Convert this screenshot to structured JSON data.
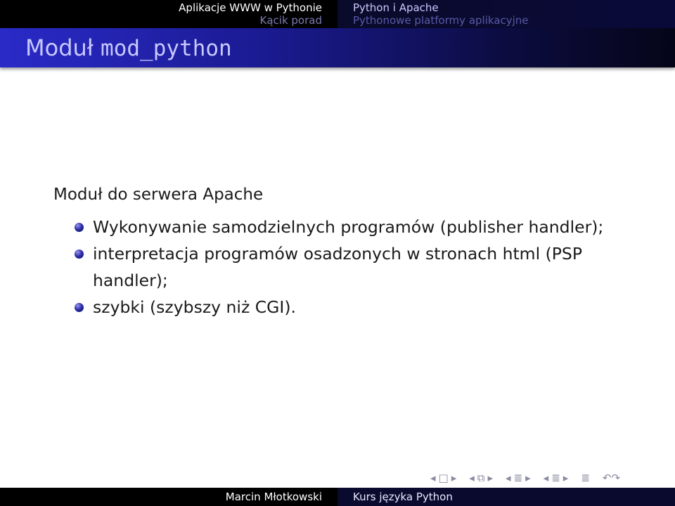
{
  "headline": {
    "left": {
      "section_current": "Aplikacje WWW w Pythonie",
      "section_other": "Kącik porad"
    },
    "right": {
      "subsection_current": "Python i Apache",
      "subsection_other": "Pythonowe platformy aplikacyjne"
    }
  },
  "frame": {
    "title_plain": "Moduł ",
    "title_mono": "mod_python"
  },
  "body": {
    "lead": "Moduł do serwera Apache",
    "bullets": [
      {
        "text": "Wykonywanie samodzielnych programów (publisher handler);"
      },
      {
        "text": "interpretacja programów osadzonych w stronach html (PSP handler);"
      },
      {
        "text": "szybki (szybszy niż CGI)."
      }
    ]
  },
  "navigation": {
    "symbols": [
      {
        "icon": "nav-frame-left-icon",
        "glyph": "◂"
      },
      {
        "icon": "nav-frame-icon",
        "glyph": "□"
      },
      {
        "icon": "nav-frame-right-icon",
        "glyph": "▸"
      },
      {
        "icon": "nav-subsection-left-icon",
        "glyph": "◂"
      },
      {
        "icon": "nav-subsection-icon",
        "glyph": "⧉"
      },
      {
        "icon": "nav-subsection-right-icon",
        "glyph": "▸"
      },
      {
        "icon": "nav-section-left-icon",
        "glyph": "◂"
      },
      {
        "icon": "nav-section-icon",
        "glyph": "≣"
      },
      {
        "icon": "nav-section-right-icon",
        "glyph": "▸"
      },
      {
        "icon": "nav-doc-left-icon",
        "glyph": "◂"
      },
      {
        "icon": "nav-doc-icon",
        "glyph": "≣"
      },
      {
        "icon": "nav-doc-right-icon",
        "glyph": "▸"
      },
      {
        "icon": "nav-appendix-icon",
        "glyph": "≣"
      },
      {
        "icon": "nav-search-icon",
        "glyph": "↶↷"
      }
    ]
  },
  "footline": {
    "author": "Marcin Młotkowski",
    "title": "Kurs języka Python"
  },
  "colors": {
    "header_bg": "#000000",
    "title_bar_start": "#2a2ac8",
    "title_text": "#c8c8ff",
    "bullet_ball": "#3030b0",
    "footer_right_bg": "#0a0a2e"
  }
}
